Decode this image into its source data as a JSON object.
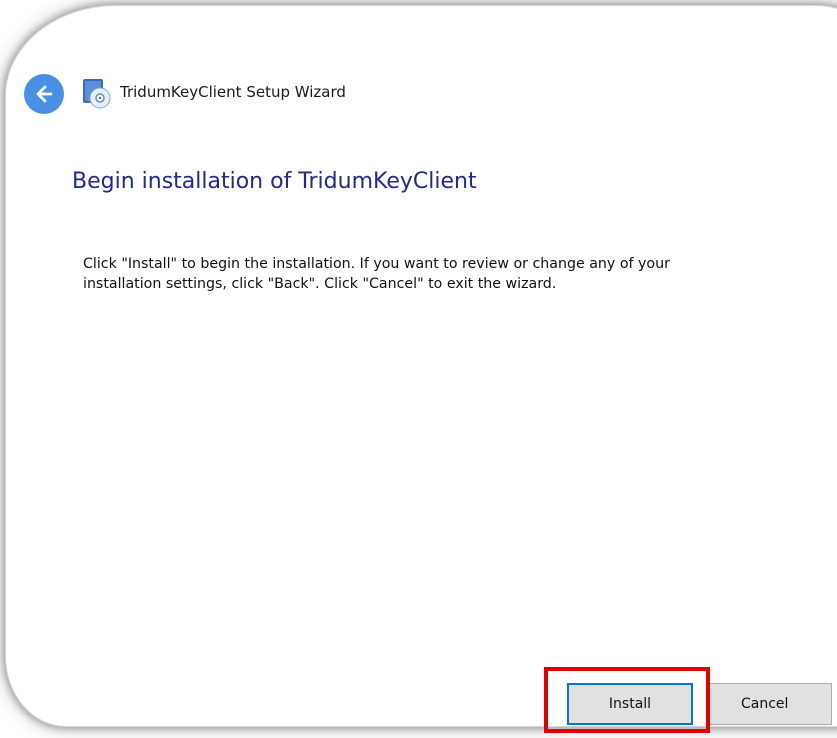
{
  "window": {
    "title": "TridumKeyClient Setup Wizard"
  },
  "header": {
    "back_icon": "back-arrow-icon",
    "app_icon": "setup-disc-icon"
  },
  "main": {
    "title": "Begin installation of TridumKeyClient",
    "description_line1": "Click \"Install\" to begin the installation.  If you want to review or change any of your",
    "description_line2": "installation settings, click \"Back\".  Click \"Cancel\" to exit the wizard."
  },
  "footer": {
    "install_label": "Install",
    "cancel_label": "Cancel"
  },
  "colors": {
    "accent": "#4a90e2",
    "title_blue": "#1f2a8c",
    "highlight_red": "#e00000",
    "focus_blue": "#0078d7"
  }
}
